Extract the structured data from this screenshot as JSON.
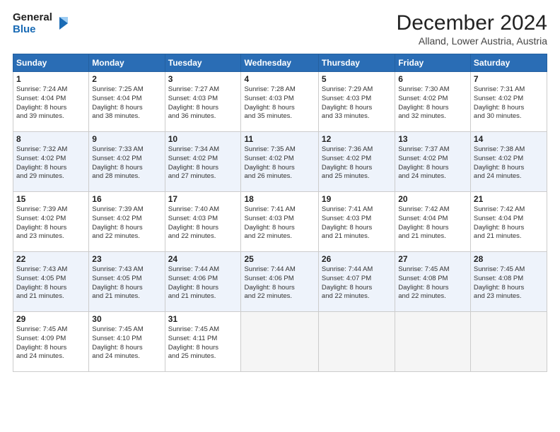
{
  "logo": {
    "line1": "General",
    "line2": "Blue"
  },
  "title": "December 2024",
  "location": "Alland, Lower Austria, Austria",
  "headers": [
    "Sunday",
    "Monday",
    "Tuesday",
    "Wednesday",
    "Thursday",
    "Friday",
    "Saturday"
  ],
  "weeks": [
    [
      {
        "day": "1",
        "lines": [
          "Sunrise: 7:24 AM",
          "Sunset: 4:04 PM",
          "Daylight: 8 hours",
          "and 39 minutes."
        ]
      },
      {
        "day": "2",
        "lines": [
          "Sunrise: 7:25 AM",
          "Sunset: 4:04 PM",
          "Daylight: 8 hours",
          "and 38 minutes."
        ]
      },
      {
        "day": "3",
        "lines": [
          "Sunrise: 7:27 AM",
          "Sunset: 4:03 PM",
          "Daylight: 8 hours",
          "and 36 minutes."
        ]
      },
      {
        "day": "4",
        "lines": [
          "Sunrise: 7:28 AM",
          "Sunset: 4:03 PM",
          "Daylight: 8 hours",
          "and 35 minutes."
        ]
      },
      {
        "day": "5",
        "lines": [
          "Sunrise: 7:29 AM",
          "Sunset: 4:03 PM",
          "Daylight: 8 hours",
          "and 33 minutes."
        ]
      },
      {
        "day": "6",
        "lines": [
          "Sunrise: 7:30 AM",
          "Sunset: 4:02 PM",
          "Daylight: 8 hours",
          "and 32 minutes."
        ]
      },
      {
        "day": "7",
        "lines": [
          "Sunrise: 7:31 AM",
          "Sunset: 4:02 PM",
          "Daylight: 8 hours",
          "and 30 minutes."
        ]
      }
    ],
    [
      {
        "day": "8",
        "lines": [
          "Sunrise: 7:32 AM",
          "Sunset: 4:02 PM",
          "Daylight: 8 hours",
          "and 29 minutes."
        ]
      },
      {
        "day": "9",
        "lines": [
          "Sunrise: 7:33 AM",
          "Sunset: 4:02 PM",
          "Daylight: 8 hours",
          "and 28 minutes."
        ]
      },
      {
        "day": "10",
        "lines": [
          "Sunrise: 7:34 AM",
          "Sunset: 4:02 PM",
          "Daylight: 8 hours",
          "and 27 minutes."
        ]
      },
      {
        "day": "11",
        "lines": [
          "Sunrise: 7:35 AM",
          "Sunset: 4:02 PM",
          "Daylight: 8 hours",
          "and 26 minutes."
        ]
      },
      {
        "day": "12",
        "lines": [
          "Sunrise: 7:36 AM",
          "Sunset: 4:02 PM",
          "Daylight: 8 hours",
          "and 25 minutes."
        ]
      },
      {
        "day": "13",
        "lines": [
          "Sunrise: 7:37 AM",
          "Sunset: 4:02 PM",
          "Daylight: 8 hours",
          "and 24 minutes."
        ]
      },
      {
        "day": "14",
        "lines": [
          "Sunrise: 7:38 AM",
          "Sunset: 4:02 PM",
          "Daylight: 8 hours",
          "and 24 minutes."
        ]
      }
    ],
    [
      {
        "day": "15",
        "lines": [
          "Sunrise: 7:39 AM",
          "Sunset: 4:02 PM",
          "Daylight: 8 hours",
          "and 23 minutes."
        ]
      },
      {
        "day": "16",
        "lines": [
          "Sunrise: 7:39 AM",
          "Sunset: 4:02 PM",
          "Daylight: 8 hours",
          "and 22 minutes."
        ]
      },
      {
        "day": "17",
        "lines": [
          "Sunrise: 7:40 AM",
          "Sunset: 4:03 PM",
          "Daylight: 8 hours",
          "and 22 minutes."
        ]
      },
      {
        "day": "18",
        "lines": [
          "Sunrise: 7:41 AM",
          "Sunset: 4:03 PM",
          "Daylight: 8 hours",
          "and 22 minutes."
        ]
      },
      {
        "day": "19",
        "lines": [
          "Sunrise: 7:41 AM",
          "Sunset: 4:03 PM",
          "Daylight: 8 hours",
          "and 21 minutes."
        ]
      },
      {
        "day": "20",
        "lines": [
          "Sunrise: 7:42 AM",
          "Sunset: 4:04 PM",
          "Daylight: 8 hours",
          "and 21 minutes."
        ]
      },
      {
        "day": "21",
        "lines": [
          "Sunrise: 7:42 AM",
          "Sunset: 4:04 PM",
          "Daylight: 8 hours",
          "and 21 minutes."
        ]
      }
    ],
    [
      {
        "day": "22",
        "lines": [
          "Sunrise: 7:43 AM",
          "Sunset: 4:05 PM",
          "Daylight: 8 hours",
          "and 21 minutes."
        ]
      },
      {
        "day": "23",
        "lines": [
          "Sunrise: 7:43 AM",
          "Sunset: 4:05 PM",
          "Daylight: 8 hours",
          "and 21 minutes."
        ]
      },
      {
        "day": "24",
        "lines": [
          "Sunrise: 7:44 AM",
          "Sunset: 4:06 PM",
          "Daylight: 8 hours",
          "and 21 minutes."
        ]
      },
      {
        "day": "25",
        "lines": [
          "Sunrise: 7:44 AM",
          "Sunset: 4:06 PM",
          "Daylight: 8 hours",
          "and 22 minutes."
        ]
      },
      {
        "day": "26",
        "lines": [
          "Sunrise: 7:44 AM",
          "Sunset: 4:07 PM",
          "Daylight: 8 hours",
          "and 22 minutes."
        ]
      },
      {
        "day": "27",
        "lines": [
          "Sunrise: 7:45 AM",
          "Sunset: 4:08 PM",
          "Daylight: 8 hours",
          "and 22 minutes."
        ]
      },
      {
        "day": "28",
        "lines": [
          "Sunrise: 7:45 AM",
          "Sunset: 4:08 PM",
          "Daylight: 8 hours",
          "and 23 minutes."
        ]
      }
    ],
    [
      {
        "day": "29",
        "lines": [
          "Sunrise: 7:45 AM",
          "Sunset: 4:09 PM",
          "Daylight: 8 hours",
          "and 24 minutes."
        ]
      },
      {
        "day": "30",
        "lines": [
          "Sunrise: 7:45 AM",
          "Sunset: 4:10 PM",
          "Daylight: 8 hours",
          "and 24 minutes."
        ]
      },
      {
        "day": "31",
        "lines": [
          "Sunrise: 7:45 AM",
          "Sunset: 4:11 PM",
          "Daylight: 8 hours",
          "and 25 minutes."
        ]
      },
      null,
      null,
      null,
      null
    ]
  ]
}
